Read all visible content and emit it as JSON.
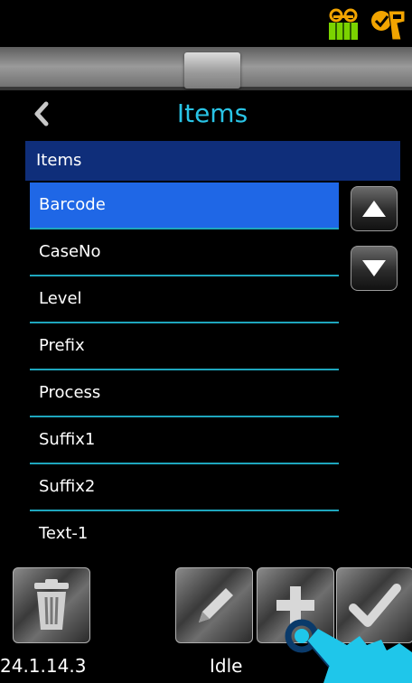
{
  "status_bar": {
    "icons": [
      "tape-reel-icon",
      "handheld-scanner-check-icon"
    ]
  },
  "header": {
    "title": "Items",
    "back_icon": "chevron-left-icon"
  },
  "list": {
    "header": "Items",
    "items": [
      {
        "label": "Barcode",
        "selected": true
      },
      {
        "label": "CaseNo",
        "selected": false
      },
      {
        "label": "Level",
        "selected": false
      },
      {
        "label": "Prefix",
        "selected": false
      },
      {
        "label": "Process",
        "selected": false
      },
      {
        "label": "Suffix1",
        "selected": false
      },
      {
        "label": "Suffix2",
        "selected": false
      },
      {
        "label": "Text-1",
        "selected": false
      }
    ]
  },
  "scroll": {
    "up_icon": "triangle-up-icon",
    "down_icon": "triangle-down-icon"
  },
  "toolbar": {
    "buttons": [
      "trash-icon",
      "pencil-icon",
      "plus-icon",
      "checkmark-icon"
    ]
  },
  "footer": {
    "version": "24.1.14.3",
    "status": "Idle"
  },
  "colors": {
    "title": "#29c4e6",
    "header_bg": "#0f2e7a",
    "selected_bg": "#1f67e6",
    "divider": "#1ea6bd"
  }
}
